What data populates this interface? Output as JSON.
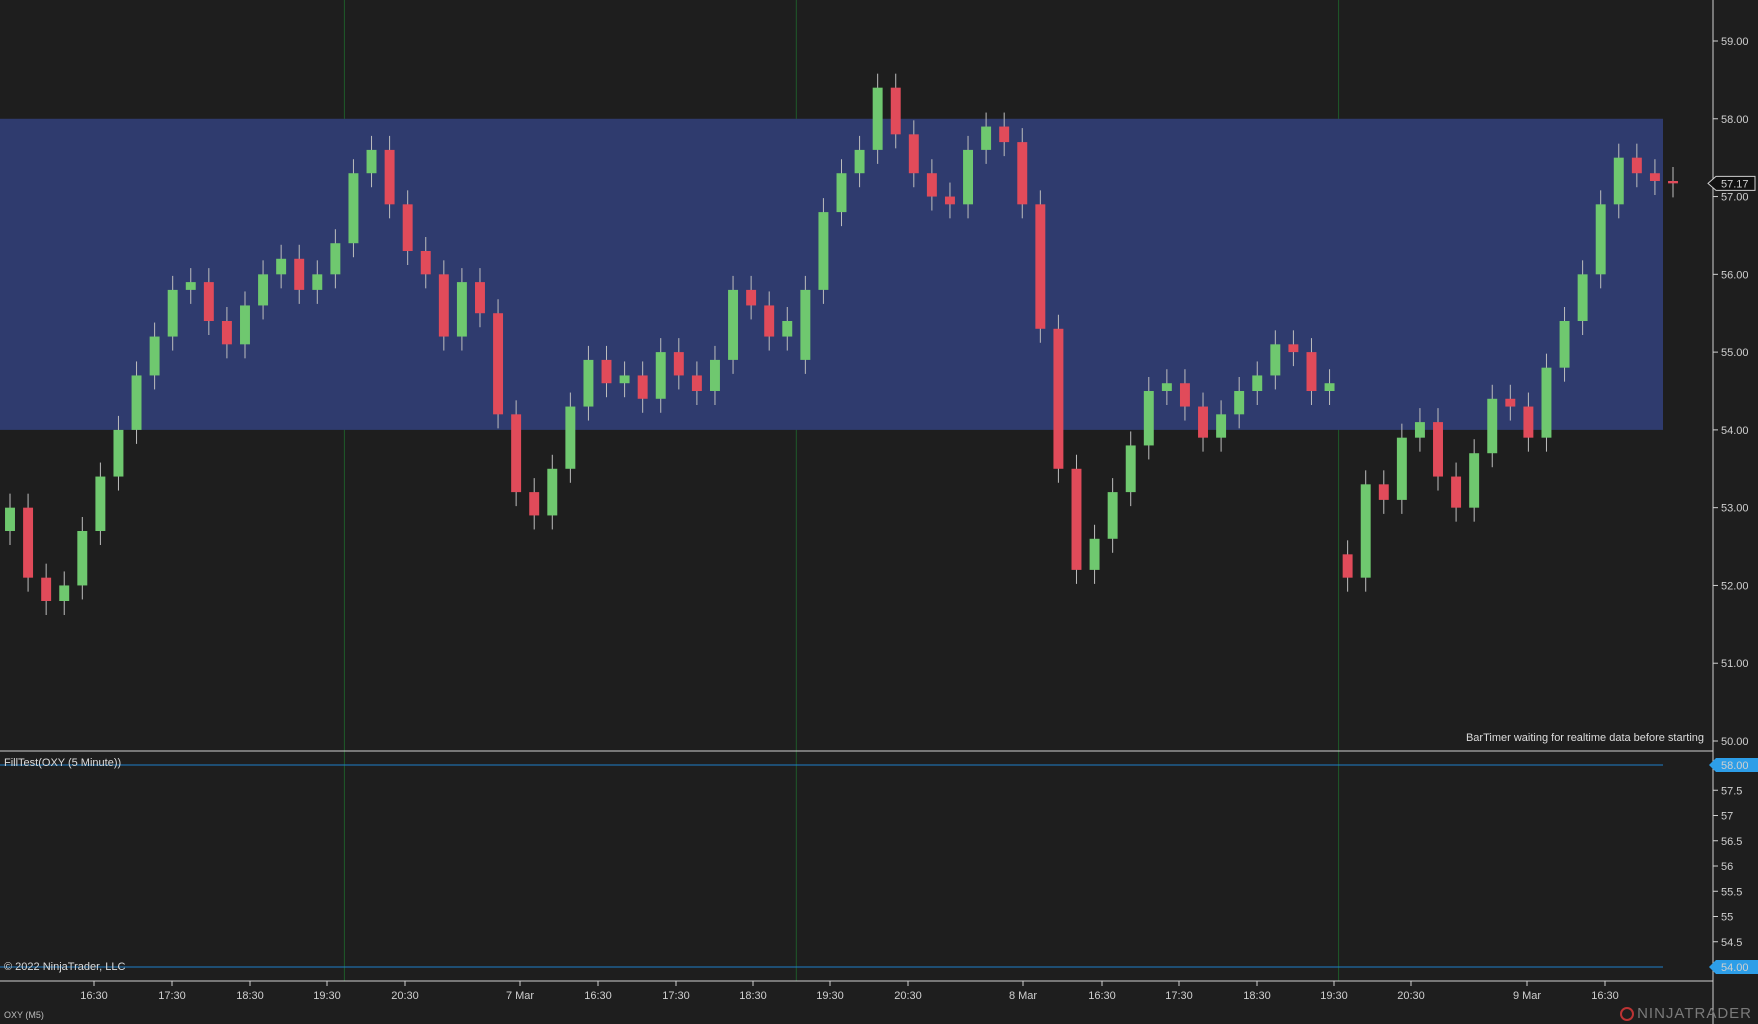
{
  "colors": {
    "background": "#1e1e1e",
    "zone_fill": "#2f3b6e",
    "up_candle": "#6fc86f",
    "down_candle": "#e14b5a",
    "wick": "#bdbdbd",
    "separator": "#d0d0d0",
    "session_line": "#1f5a2a",
    "level_line": "#1e7fc8",
    "level_label_bg": "#2d9ee8",
    "price_marker_border": "#cfcfcf"
  },
  "main_panel": {
    "annotation": "BarTimer waiting for realtime data before starting",
    "current_price_label": "57.17",
    "y_ticks": [
      "59.00",
      "58.00",
      "57.00",
      "56.00",
      "55.00",
      "54.00",
      "53.00",
      "52.00",
      "51.00",
      "50.00"
    ]
  },
  "indicator_panel": {
    "label": "FillTest(OXY (5 Minute))",
    "copyright": "© 2022 NinjaTrader, LLC",
    "upper_level_label": "58.00",
    "lower_level_label": "54.00",
    "y_ticks": [
      "57.5",
      "57",
      "56.5",
      "56",
      "55.5",
      "55",
      "54.5"
    ]
  },
  "x_axis": {
    "labels": [
      "16:30",
      "17:30",
      "18:30",
      "19:30",
      "20:30",
      "7 Mar",
      "16:30",
      "17:30",
      "18:30",
      "19:30",
      "20:30",
      "8 Mar",
      "16:30",
      "17:30",
      "18:30",
      "19:30",
      "20:30",
      "9 Mar",
      "16:30"
    ]
  },
  "footer": {
    "instrument": "OXY (M5)",
    "logo_text": "NINJATRADER"
  },
  "chart_data": {
    "type": "candlestick",
    "instrument": "OXY (M5)",
    "y_axis_range": [
      50,
      59.2
    ],
    "zone": {
      "from": 54.0,
      "to": 58.0
    },
    "last_price": 57.17,
    "sessions": [
      {
        "label": "",
        "closes": [
          53.0,
          52.1,
          51.8,
          52.0,
          52.7,
          53.4,
          54.0,
          54.7,
          55.2,
          55.8,
          55.9,
          55.4,
          55.1,
          55.6,
          56.0,
          56.2,
          55.8,
          56.0,
          56.4
        ]
      },
      {
        "label": "7 Mar",
        "closes": [
          57.3,
          57.6,
          56.9,
          56.3,
          56.0,
          55.2,
          55.9,
          55.5,
          54.2,
          53.2,
          52.9,
          53.5,
          54.3,
          54.9,
          54.6,
          54.7,
          54.4,
          55.0,
          54.7,
          54.5,
          54.9,
          55.8,
          55.6,
          55.2,
          55.4
        ]
      },
      {
        "label": "8 Mar",
        "closes": [
          55.8,
          56.8,
          57.3,
          57.6,
          58.4,
          57.8,
          57.3,
          57.0,
          56.9,
          57.6,
          57.9,
          57.7,
          56.9,
          55.3,
          53.5,
          52.2,
          52.6,
          53.2,
          53.8,
          54.5,
          54.6,
          54.3,
          53.9,
          54.2,
          54.5,
          54.7,
          55.1,
          55.0,
          54.5,
          54.6
        ]
      },
      {
        "label": "9 Mar",
        "closes": [
          52.1,
          53.3,
          53.1,
          53.9,
          54.1,
          53.4,
          53.0,
          53.7,
          54.4,
          54.3,
          53.9,
          54.8,
          55.4,
          56.0,
          56.9,
          57.5,
          57.3,
          57.2,
          57.17
        ]
      }
    ],
    "indicator": {
      "name": "FillTest(OXY (5 Minute))",
      "upper": 58.0,
      "lower": 54.0,
      "y_axis_range": [
        53.6,
        58.2
      ]
    }
  }
}
